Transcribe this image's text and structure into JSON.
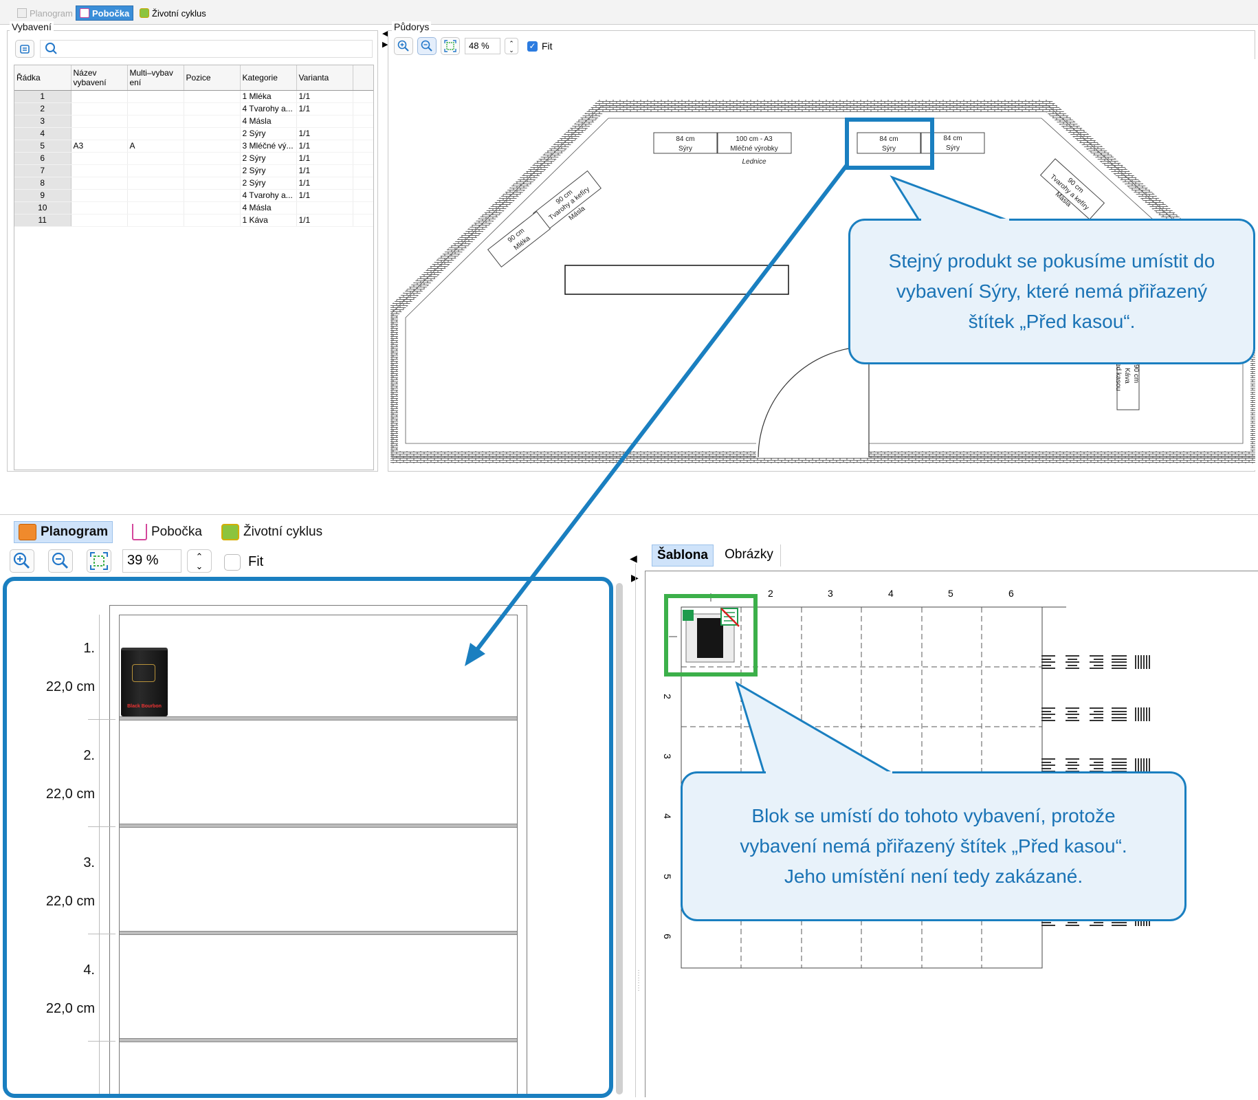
{
  "top": {
    "tabs": [
      {
        "label": "Planogram",
        "state": "disabled",
        "icon": "planogram-icon"
      },
      {
        "label": "Pobočka",
        "state": "selected",
        "icon": "store-icon"
      },
      {
        "label": "Životní cyklus",
        "state": "normal",
        "icon": "lifecycle-icon"
      }
    ],
    "equipment": {
      "group_label": "Vybavení",
      "columns": [
        "Řádka",
        "Název vybavení",
        "Multi–vybav ení",
        "Pozice",
        "Kategorie",
        "Varianta"
      ],
      "rows": [
        {
          "n": "1",
          "name": "",
          "multi": "",
          "pos": "",
          "cat": "1 Mléka",
          "var": "1/1"
        },
        {
          "n": "2",
          "name": "",
          "multi": "",
          "pos": "",
          "cat": "4 Tvarohy a...",
          "var": "1/1"
        },
        {
          "n": "3",
          "name": "",
          "multi": "",
          "pos": "",
          "cat": "4 Másla",
          "var": ""
        },
        {
          "n": "4",
          "name": "",
          "multi": "",
          "pos": "",
          "cat": "2 Sýry",
          "var": "1/1"
        },
        {
          "n": "5",
          "name": "A3",
          "multi": "A",
          "pos": "",
          "cat": "3 Mléčné vý...",
          "var": "1/1"
        },
        {
          "n": "6",
          "name": "",
          "multi": "",
          "pos": "",
          "cat": "2 Sýry",
          "var": "1/1"
        },
        {
          "n": "7",
          "name": "",
          "multi": "",
          "pos": "",
          "cat": "2 Sýry",
          "var": "1/1"
        },
        {
          "n": "8",
          "name": "",
          "multi": "",
          "pos": "",
          "cat": "2 Sýry",
          "var": "1/1"
        },
        {
          "n": "9",
          "name": "",
          "multi": "",
          "pos": "",
          "cat": "4 Tvarohy a...",
          "var": "1/1"
        },
        {
          "n": "10",
          "name": "",
          "multi": "",
          "pos": "",
          "cat": "4 Másla",
          "var": ""
        },
        {
          "n": "11",
          "name": "",
          "multi": "",
          "pos": "",
          "cat": "1 Káva",
          "var": "1/1"
        }
      ]
    },
    "floorplan": {
      "group_label": "Půdorys",
      "zoom": "48 %",
      "fit_label": "Fit",
      "fit_checked": true,
      "fixtures": {
        "f1_size": "84 cm",
        "f1_cat": "Sýry",
        "f2_size": "100 cm - A3",
        "f2_cat": "Mléčné výrobky",
        "f2_sub": "Lednice",
        "f3_size": "84 cm",
        "f3_cat": "Sýry",
        "f4_size": "84 cm",
        "f4_cat": "Sýry",
        "d1_size": "90 cm",
        "d1_cat": "Tvarohy a kefíry",
        "d1_sub": "Másla",
        "d2_size": "90 cm",
        "d2_cat": "Mléka",
        "r1_size": "90 cm",
        "r1_cat": "Tvarohy a kefíry",
        "r1_sub": "Másla",
        "r2_size": "90 cm",
        "r2_cat": "Káva",
        "r2_sub": "ed kasou"
      }
    }
  },
  "bottom": {
    "tabs": [
      {
        "label": "Planogram",
        "state": "selected",
        "icon": "planogram-icon"
      },
      {
        "label": "Pobočka",
        "state": "normal",
        "icon": "store-icon"
      },
      {
        "label": "Životní cyklus",
        "state": "normal",
        "icon": "lifecycle-icon"
      }
    ],
    "zoom": "39 %",
    "fit_label": "Fit",
    "fit_checked": false,
    "shelves": [
      {
        "num": "1.",
        "height": "22,0 cm"
      },
      {
        "num": "2.",
        "height": "22,0 cm"
      },
      {
        "num": "3.",
        "height": "22,0 cm"
      },
      {
        "num": "4.",
        "height": "22,0 cm"
      }
    ],
    "product_label": "Black Bourbon",
    "template_tabs": [
      "Šablona",
      "Obrázky"
    ],
    "template_cols": [
      "2",
      "3",
      "4",
      "5",
      "6"
    ],
    "template_rows": [
      "2",
      "3",
      "4",
      "5",
      "6"
    ]
  },
  "callouts": {
    "top": "Stejný produkt se pokusíme umístit do vybavení Sýry, které nemá přiřazený štítek „Před kasou“.",
    "bottom": "Blok se umístí do tohoto vybavení, protože vybavení nemá přiřazený štítek „Před kasou“. Jeho umístění není tedy zakázané."
  },
  "colors": {
    "accent": "#1a7fc0",
    "highlight_green": "#3cb04a",
    "callout_bg": "#e8f2fa"
  }
}
